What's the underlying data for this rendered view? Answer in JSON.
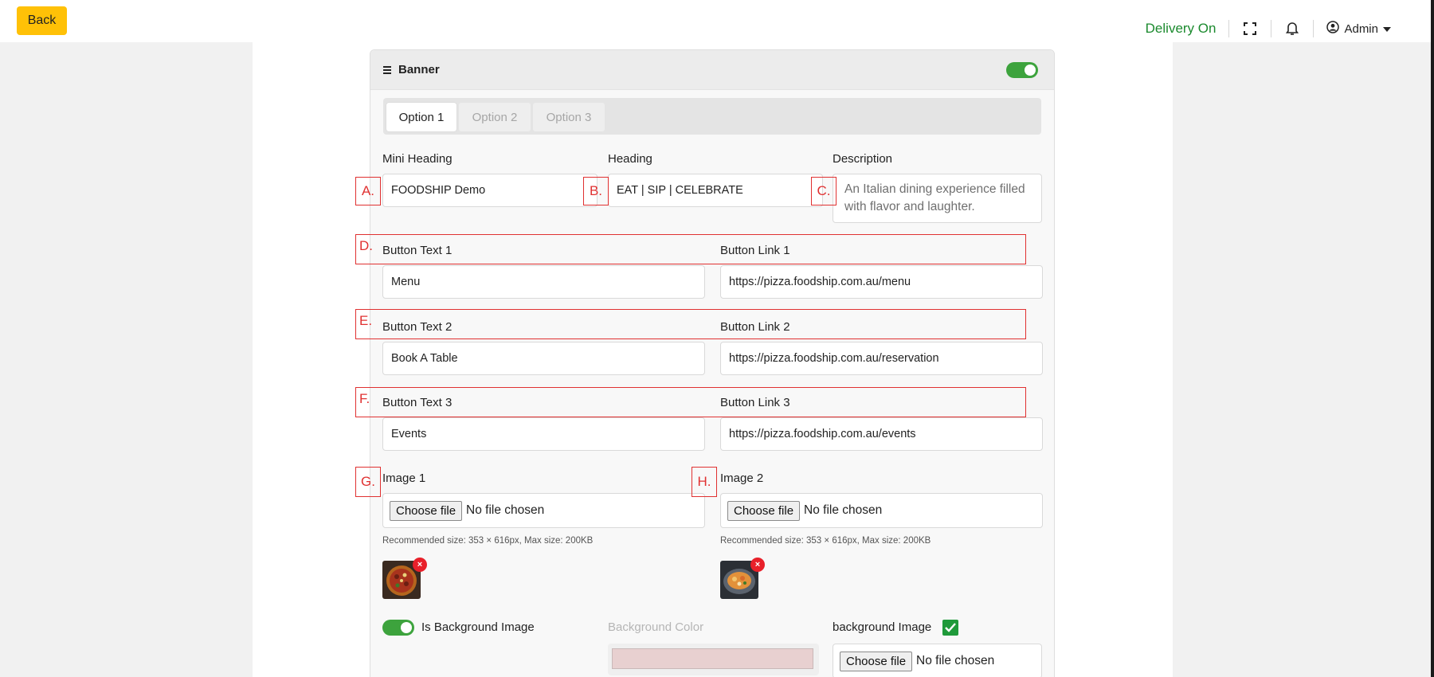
{
  "topbar": {
    "back_label": "Back",
    "delivery_label": "Delivery On",
    "admin_label": "Admin"
  },
  "card": {
    "title": "Banner",
    "enabled": true,
    "tabs": [
      {
        "label": "Option 1",
        "active": true
      },
      {
        "label": "Option 2",
        "active": false
      },
      {
        "label": "Option 3",
        "active": false
      }
    ],
    "mini_heading": {
      "label": "Mini Heading",
      "value": "FOODSHIP Demo"
    },
    "heading": {
      "label": "Heading",
      "value": "EAT | SIP | CELEBRATE"
    },
    "description": {
      "label": "Description",
      "value": "An Italian dining experience filled with flavor and laughter."
    },
    "buttons": [
      {
        "text_label": "Button Text 1",
        "text_value": "Menu",
        "link_label": "Button Link 1",
        "link_value": "https://pizza.foodship.com.au/menu"
      },
      {
        "text_label": "Button Text 2",
        "text_value": "Book A Table",
        "link_label": "Button Link 2",
        "link_value": "https://pizza.foodship.com.au/reservation"
      },
      {
        "text_label": "Button Text 3",
        "text_value": "Events",
        "link_label": "Button Link 3",
        "link_value": "https://pizza.foodship.com.au/events"
      }
    ],
    "image1": {
      "label": "Image 1",
      "choose_label": "Choose file",
      "status": "No file chosen",
      "hint": "Recommended size: 353 × 616px, Max size: 200KB"
    },
    "image2": {
      "label": "Image 2",
      "choose_label": "Choose file",
      "status": "No file chosen",
      "hint": "Recommended size: 353 × 616px, Max size: 200KB"
    },
    "is_background_image": {
      "label": "Is Background Image",
      "on": true
    },
    "background_color": {
      "label": "Background Color",
      "value": "#e8d0d0"
    },
    "background_image": {
      "label": "background Image",
      "choose_label": "Choose file",
      "status": "No file chosen",
      "checked": true
    },
    "remove_label": "×"
  },
  "annotations": {
    "a": "A.",
    "b": "B.",
    "c": "C.",
    "d": "D.",
    "e": "E.",
    "f": "F.",
    "g": "G.",
    "h": "H."
  },
  "colors": {
    "accent_yellow": "#ffc107",
    "delivery_green": "#1b8a2e",
    "toggle_green": "#3da33d",
    "annotation_red": "#e03131",
    "remove_red": "#e8202a"
  }
}
